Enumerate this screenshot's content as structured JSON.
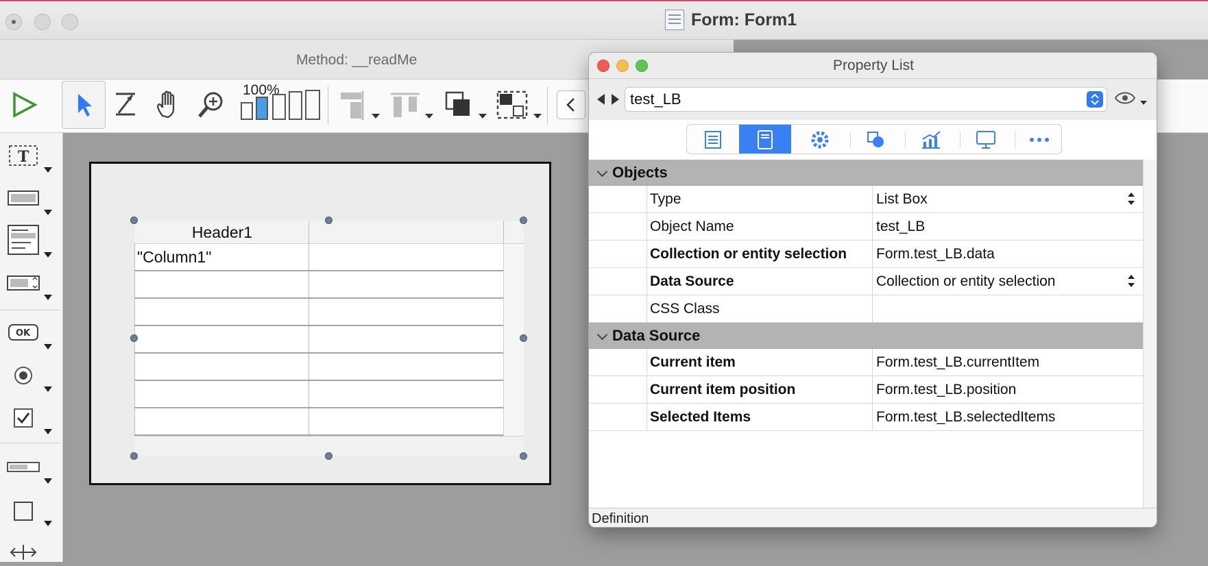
{
  "window": {
    "title": "Form: Form1",
    "method_title": "Method: __readMe"
  },
  "toolbar": {
    "zoom_label": "100%",
    "icons": [
      "run-icon",
      "arrow-pointer-icon",
      "layers-icon",
      "hand-icon",
      "zoom-icon",
      "zoom-bars-icon",
      "align-icon",
      "distribute-icon",
      "arrange-icon",
      "group-icon",
      "nav-back-icon"
    ]
  },
  "canvas": {
    "listbox": {
      "headers": [
        "Header1",
        ""
      ],
      "first_cell": "\"Column1\""
    }
  },
  "property_list": {
    "title": "Property List",
    "object_selector": "test_LB",
    "tabs": [
      "list-icon",
      "form-object-icon",
      "gear-icon",
      "shapes-icon",
      "chart-icon",
      "display-icon",
      "more-icon"
    ],
    "active_tab": 1,
    "sections": [
      {
        "label": "Objects",
        "rows": [
          {
            "name": "Type",
            "value": "List Box",
            "bold": false,
            "stepper": true
          },
          {
            "name": "Object Name",
            "value": "test_LB",
            "bold": false,
            "stepper": false
          },
          {
            "name": "Collection or entity selection",
            "value": "Form.test_LB.data",
            "bold": true,
            "stepper": false
          },
          {
            "name": "Data Source",
            "value": "Collection or entity selection",
            "bold": true,
            "stepper": true
          },
          {
            "name": "CSS Class",
            "value": "",
            "bold": false,
            "stepper": false
          }
        ]
      },
      {
        "label": "Data Source",
        "rows": [
          {
            "name": "Current item",
            "value": "Form.test_LB.currentItem",
            "bold": true,
            "stepper": false
          },
          {
            "name": "Current item position",
            "value": "Form.test_LB.position",
            "bold": true,
            "stepper": false
          },
          {
            "name": "Selected Items",
            "value": "Form.test_LB.selectedItems",
            "bold": true,
            "stepper": false
          }
        ]
      }
    ],
    "footer_label": "Definition"
  },
  "colors": {
    "accent": "#3a80f5",
    "run_green": "#3a9a2e",
    "close_red": "#ee5c52",
    "minimize_yellow": "#f4be4f",
    "zoom_green": "#5fc454"
  }
}
